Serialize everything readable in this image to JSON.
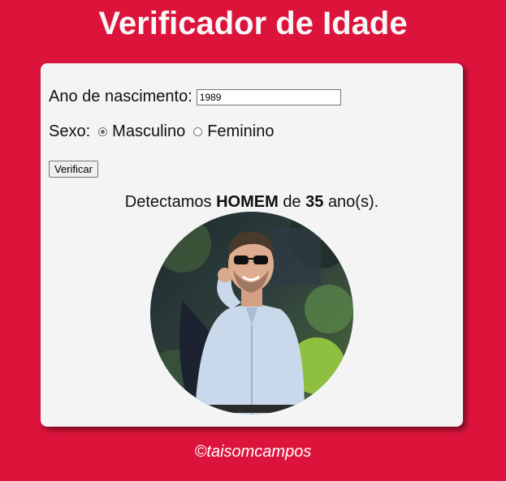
{
  "title": "Verificador de Idade",
  "form": {
    "year_label": "Ano de nascimento:",
    "year_value": "1989",
    "sex_label": "Sexo:",
    "options": [
      {
        "label": "Masculino",
        "selected": true
      },
      {
        "label": "Feminino",
        "selected": false
      }
    ],
    "verify_button": "Verificar"
  },
  "result": {
    "prefix": "Detectamos",
    "gender": "HOMEM",
    "middle": "de",
    "age": "35",
    "suffix": "ano(s)."
  },
  "footer": "©taisomcampos",
  "colors": {
    "background": "#dc143c",
    "card": "#f4f4f4",
    "title": "#f7f7f7"
  }
}
